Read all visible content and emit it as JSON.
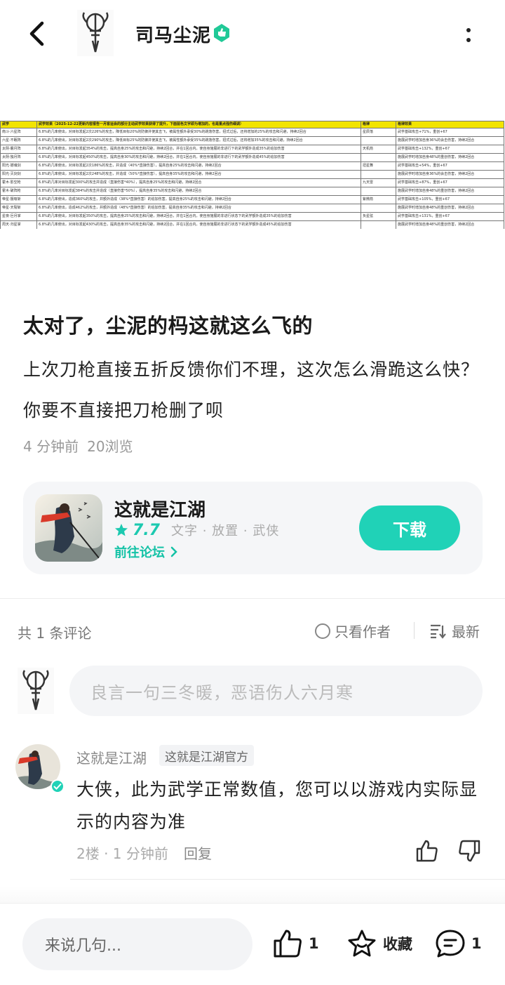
{
  "header": {
    "author_name": "司马尘泥"
  },
  "table": {
    "headers": [
      "武学",
      "武学效果（2025-12-22更新内容报告一月客运会的部分主动武学效果获得了提升，下面蓝色文字即为增加的，也是重点强伤细调）",
      "格律",
      "格律效果"
    ],
    "rows": [
      [
        "南斗·六星阵",
        "6.8%的几率使出，对目标发起2次226%的攻击，降低目标20%的防御并使其击飞，被属性额外承受30%的跳落伤害，招式过后，还将增加的25%的攻击和闪避，持续2回合",
        "星辰落",
        "武学基础攻击+71%，重创+67"
      ],
      [
        "六星·不眠阵",
        "6.8%的几率使出，对目标发起2次290%的攻击，降低目标25%的防御并使其击飞，被属性额外承受35%的跳落伤害，招式过后，还将增加35%的攻击和闪避，持续2回合",
        "",
        "施展武学时增加自身36%的会击伤害，持续2回合"
      ],
      [
        "太阴·霰月阵",
        "6.8%的几率使出，对目标发起354%的攻击，提高自身25%的攻击和闪避，持续2回合，并在1回合内，使自身施展的非进行下的武学额外造成35%的追加伤害",
        "天机箭",
        "武学基础攻击+132%，重创+67"
      ],
      [
        "太阴·独月阵",
        "6.8%的几率使出，对目标发起450%的攻击，提高自身30%的攻击和闪避，持续2回合，并在1回合内，使自身施展的非进行下的武学额外造成45%的追加伤害",
        "",
        "施展武学时增加自身48%的重创伤害，持续2回合"
      ],
      [
        "阳光·撼魂剑",
        "6.8%的几率使出，对目标发起2次186%的攻击，并造成（40%*直接伤害），提高自身25%的攻击和闪避，持续2回合",
        "扭星舞",
        "武学基础攻击+54%，重创+67"
      ],
      [
        "阳光·灭剑剑",
        "6.8%的几率使出，对目标发起2次248%的攻击，并造成（50%*直接伤害），提高自身35%的攻击和闪避，持续2回合",
        "",
        "施展武学时增加自身36%的会击伤害，持续2回合"
      ],
      [
        "霍木·影空枪",
        "6.8%的几率对目标发起300%的攻击并造成（直接伤害*40%），提高自身25%的攻击和闪避，持续2回合",
        "九天雷",
        "武学基础攻击+87%，重创+67"
      ],
      [
        "霍木·破阵枪",
        "6.8%的几率对目标发起384%的攻击并造成（直接伤害*50%），提高自身35%的攻击和闪避，持续2回合",
        "",
        "施展武学时增加自身48%的重创伤害，持续2回合"
      ],
      [
        "帝星·摄吸斩",
        "6.8%的几率使出，造成360%的攻击，并额外造成（38%*直接伤害）的追加伤害，提高自身25%的攻击和闪避，持续2回合",
        "紫微箭",
        "武学基础攻击+105%，重创+67"
      ],
      [
        "帝星·天裂斩",
        "6.8%的几率使出，造成462%的攻击，并额外造成（48%*直接伤害）的追加伤害，提高自身35%的攻击和闪避，持续2回合",
        "",
        "施展武学时增加自身48%的重创伤害，持续2回合"
      ],
      [
        "星夜·巨月掌",
        "6.8%的几率使出，对目标发起350%的攻击，提高自身25%的攻击和闪避，持续2回合，并在1回合内，使自身施展的非进行状态下的武学额外造成35%的追加伤害",
        "负星弦",
        "武学基础攻击+131%，重创+67"
      ],
      [
        "周天·归星掌",
        "6.8%的几率使出，对目标发起430%的攻击，提高自身35%的攻击和闪避，持续2回合，并在1回合内，使自身施展的非进行状态下的武学额外造成45%的追加伤害",
        "",
        "施展武学时增加自身48%的重创伤害，持续2回合"
      ]
    ]
  },
  "post": {
    "title": "太对了，尘泥的杩这就这么飞的",
    "body": "上次刀枪直接五折反馈你们不理，这次怎么滑跪这么快？你要不直接把刀枪删了呗",
    "time": "4 分钟前",
    "views": "20浏览"
  },
  "app": {
    "name": "这就是江湖",
    "score": "7.7",
    "tags": "文字 · 放置 · 武侠",
    "forum_link": "前往论坛",
    "download_label": "下载",
    "accent": "#20d2b7"
  },
  "comments": {
    "count_label": "共 1 条评论",
    "only_author": "只看作者",
    "sort_label": "最新",
    "input_placeholder": "良言一句三冬暖，恶语伤人六月寒"
  },
  "reply": {
    "name": "这就是江湖",
    "tag": "这就是江湖官方",
    "text": "大侠，此为武学正常数值，您可以以游戏内实际显示的内容为准",
    "meta": "2楼 · 1 分钟前",
    "reply_label": "回复"
  },
  "bottom": {
    "input_placeholder": "来说几句...",
    "like_count": "1",
    "collect_label": "收藏",
    "comment_count": "1"
  },
  "icons": [
    "back-icon",
    "verified-icon",
    "more-icon",
    "star-icon",
    "chevron-right-icon",
    "radio-icon",
    "sort-icon",
    "like-icon",
    "dislike-icon",
    "collect-icon",
    "comment-icon"
  ]
}
